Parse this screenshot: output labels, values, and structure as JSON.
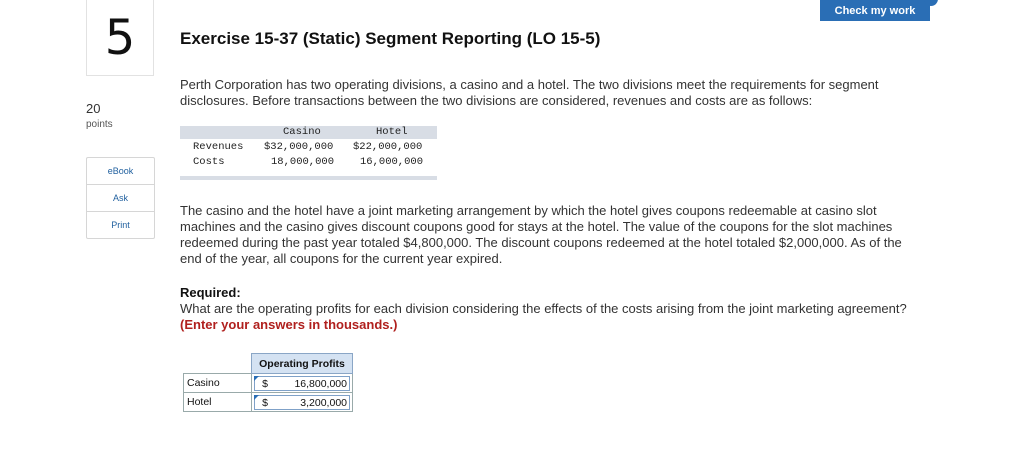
{
  "question": {
    "number": "5",
    "points_value": "20",
    "points_label": "points"
  },
  "tools": {
    "ebook": "eBook",
    "ask": "Ask",
    "print": "Print"
  },
  "header": {
    "check_button": "Check my work"
  },
  "exercise": {
    "title": "Exercise 15-37 (Static) Segment Reporting (LO 15-5)",
    "intro": "Perth Corporation has two operating divisions, a casino and a hotel. The two divisions meet the requirements for segment disclosures. Before transactions between the two divisions are considered, revenues and costs are as follows:",
    "data_table": {
      "col_casino": "Casino",
      "col_hotel": "Hotel",
      "rows": [
        {
          "label": "Revenues",
          "casino": "$32,000,000",
          "hotel": "$22,000,000"
        },
        {
          "label": "Costs",
          "casino": "18,000,000",
          "hotel": "16,000,000"
        }
      ]
    },
    "paragraph2": "The casino and the hotel have a joint marketing arrangement by which the hotel gives coupons redeemable at casino slot machines and the casino gives discount coupons good for stays at the hotel. The value of the coupons for the slot machines redeemed during the past year totaled $4,800,000. The discount coupons redeemed at the hotel totaled $2,000,000. As of the end of the year, all coupons for the current year expired.",
    "required_heading": "Required:",
    "required_question": "What are the operating profits for each division considering the effects of the costs arising from the joint marketing agreement?",
    "required_note": "(Enter your answers in thousands.)"
  },
  "answer_table": {
    "header": "Operating Profits",
    "rows": [
      {
        "label": "Casino",
        "currency": "$",
        "value": "16,800,000"
      },
      {
        "label": "Hotel",
        "currency": "$",
        "value": "3,200,000"
      }
    ]
  }
}
